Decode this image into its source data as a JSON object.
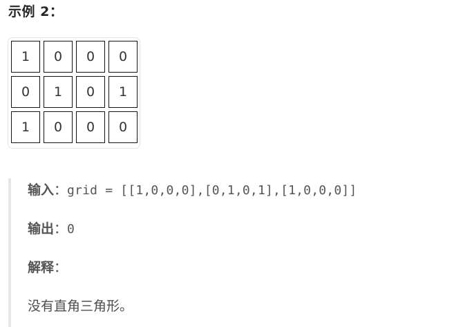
{
  "heading": "示例 2：",
  "grid": [
    [
      "1",
      "0",
      "0",
      "0"
    ],
    [
      "0",
      "1",
      "0",
      "1"
    ],
    [
      "1",
      "0",
      "0",
      "0"
    ]
  ],
  "input": {
    "label": "输入",
    "colon": "：",
    "value": "grid = [[1,0,0,0],[0,1,0,1],[1,0,0,0]]"
  },
  "output": {
    "label": "输出",
    "colon": "：",
    "value": "0"
  },
  "explanation": {
    "label": "解释",
    "colon": "：",
    "text": "没有直角三角形。"
  }
}
